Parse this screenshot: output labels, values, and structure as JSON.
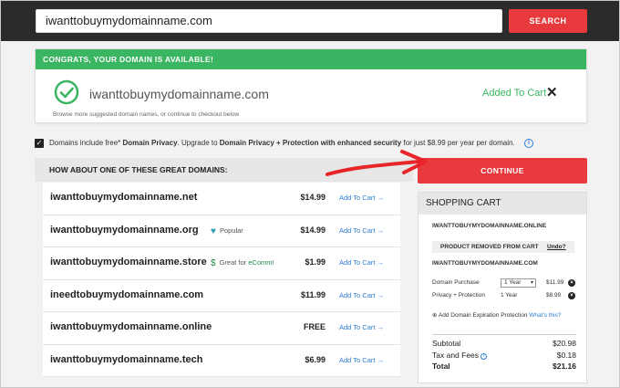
{
  "search": {
    "value": "iwanttobuymydomainname.com",
    "button": "SEARCH"
  },
  "availability": {
    "banner": "CONGRATS, YOUR DOMAIN IS AVAILABLE!",
    "domain": "iwanttobuymydomainname.com",
    "subtext": "Browse more suggested domain names, or continue to checkout below",
    "added_label": "Added To Cart",
    "close": "✕"
  },
  "privacy": {
    "checked": true,
    "text_prefix": "Domains include free* ",
    "text_bold1": "Domain Privacy",
    "text_mid": ". Upgrade to ",
    "text_bold2": "Domain Privacy + Protection with enhanced security",
    "text_suffix": " for just $8.99 per year per domain."
  },
  "suggestions": {
    "header": "HOW ABOUT ONE OF THESE GREAT DOMAINS:",
    "add_label": "Add To Cart  →",
    "items": [
      {
        "name": "iwanttobuymydomainname.net",
        "tag": "",
        "price": "$14.99"
      },
      {
        "name": "iwanttobuymydomainname.org",
        "tag": "Popular",
        "price": "$14.99"
      },
      {
        "name": "iwanttobuymydomainname.store",
        "tag_prefix": "Great for ",
        "tag_link": "eComm!",
        "price": "$1.99"
      },
      {
        "name": "ineedtobuymydomainname.com",
        "tag": "",
        "price": "$11.99"
      },
      {
        "name": "iwanttobuymydomainname.online",
        "tag": "",
        "price": "FREE"
      },
      {
        "name": "iwanttobuymydomainname.tech",
        "tag": "",
        "price": "$6.99"
      }
    ]
  },
  "continue_button": "CONTINUE",
  "cart": {
    "title": "SHOPPING CART",
    "removed_domain": "IWANTTOBUYMYDOMAINNAME.ONLINE",
    "removed_label": "PRODUCT REMOVED FROM CART",
    "undo": "Undo?",
    "domain": "IWANTTOBUYMYDOMAINNAME.COM",
    "lines": [
      {
        "label": "Domain Purchase",
        "term": "1 Year",
        "price": "$11.99"
      },
      {
        "label": "Privacy + Protection",
        "term": "1 Year",
        "price": "$8.99"
      }
    ],
    "add_protection": "Add Domain Expiration Protection",
    "whats_this": "What's this?",
    "subtotal_label": "Subtotal",
    "subtotal": "$20.98",
    "tax_label": "Tax and Fees",
    "tax": "$0.18",
    "total_label": "Total",
    "total": "$21.16"
  },
  "colors": {
    "accent_red": "#e8393d",
    "success_green": "#3ab561",
    "link_blue": "#2b7cd3"
  }
}
